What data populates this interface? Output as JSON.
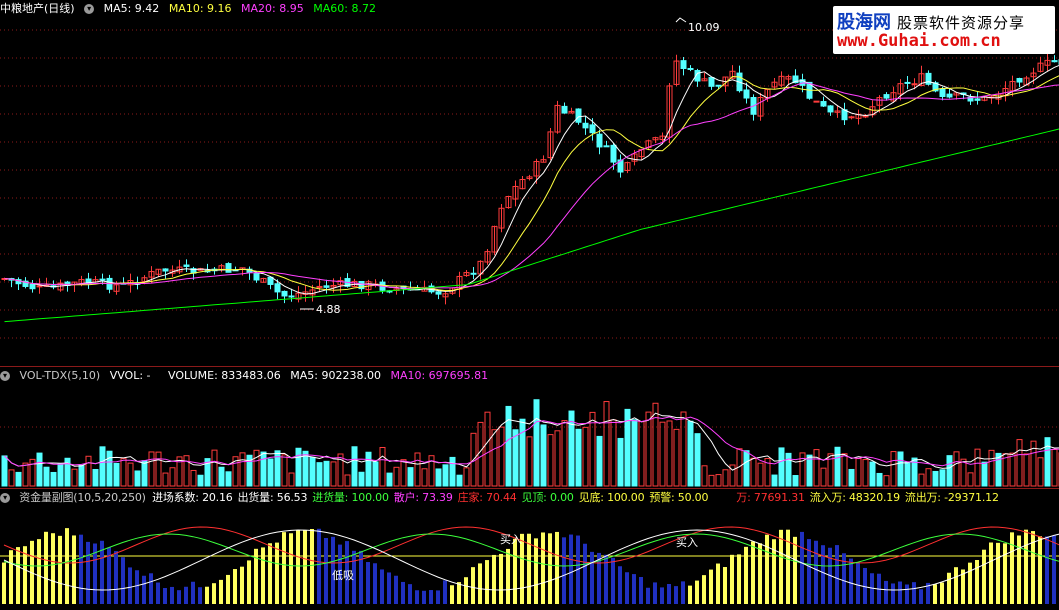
{
  "panel1": {
    "name": "中粮地产(日线)",
    "ma5": "MA5: 9.42",
    "ma10": "MA10: 9.16",
    "ma20": "MA20: 8.95",
    "ma60": "MA60: 8.72",
    "high_label": "10.09",
    "low_label": "4.88"
  },
  "panel2": {
    "name": "VOL-TDX(5,10)",
    "vvol": "VVOL: -",
    "volume": "VOLUME: 833483.06",
    "ma5": "MA5: 902238.00",
    "ma10": "MA10: 697695.81"
  },
  "panel3": {
    "name": "资金量副图(10,5,20,250)",
    "items": [
      {
        "text": "进场系数: 20.16",
        "color": "#ffffff"
      },
      {
        "text": "出货量: 56.53",
        "color": "#ffffff"
      },
      {
        "text": "进货量: 100.00",
        "color": "#3cff3c"
      },
      {
        "text": "散户: 73.39",
        "color": "#ff40ff"
      },
      {
        "text": "庄家: 70.44",
        "color": "#ff3030"
      },
      {
        "text": "见顶: 0.00",
        "color": "#3cff3c"
      },
      {
        "text": "见底: 100.00",
        "color": "#ffff40"
      },
      {
        "text": "预警: 50.00",
        "color": "#ffff40"
      },
      {
        "text": "万: 77691.31",
        "color": "#ff3030"
      },
      {
        "text": "流入万: 48320.19",
        "color": "#ffff40"
      },
      {
        "text": "流出万: -29371.12",
        "color": "#ffff40"
      }
    ],
    "label_low": "低吸",
    "label_buy": "买入"
  },
  "watermark": {
    "line1": "股海网",
    "line1b": "股票软件资源分享",
    "line2": "www.Guhai.com.cn"
  },
  "colors": {
    "up": "#ff3c3c",
    "down": "#54ffff",
    "ma5": "#ffffff",
    "ma10": "#ffff40",
    "ma20": "#ff40ff",
    "ma60": "#00ff00",
    "grid": "#8b1a1a"
  }
}
